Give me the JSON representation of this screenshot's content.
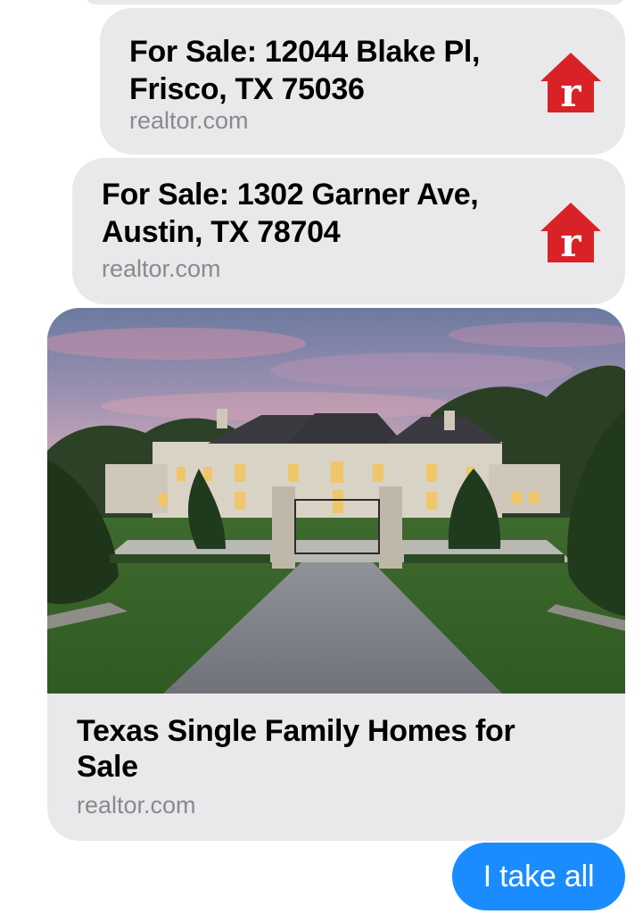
{
  "messages": [
    {
      "type": "link",
      "title_line1": "For Sale: 12044 Blake Pl,",
      "title_line2": "Frisco, TX 75036",
      "domain": "realtor.com",
      "icon": "realtor-logo-icon"
    },
    {
      "type": "link",
      "title_line1": "For Sale: 1302 Garner Ave,",
      "title_line2": "Austin, TX 78704",
      "domain": "realtor.com",
      "icon": "realtor-logo-icon"
    },
    {
      "type": "link-card",
      "title_line1": "Texas Single Family Homes for",
      "title_line2": "Sale",
      "domain": "realtor.com",
      "image": "mansion-photo"
    }
  ],
  "sent_message": {
    "text": "I take all"
  },
  "colors": {
    "bubble_gray": "#e9e9eb",
    "sent_blue": "#1a8cff",
    "realtor_red": "#d92228",
    "domain_gray": "#8a8a8e"
  }
}
